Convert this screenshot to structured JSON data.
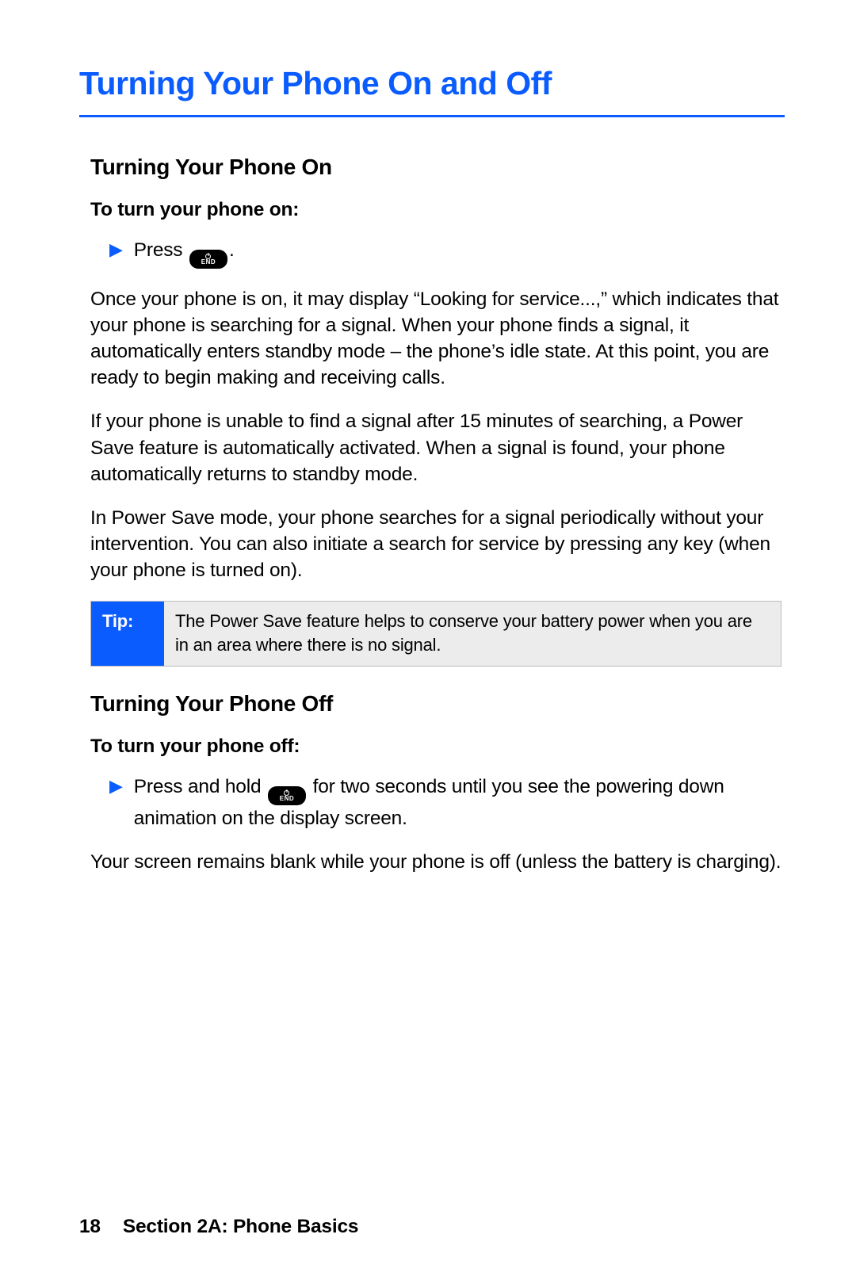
{
  "title": "Turning Your Phone On and Off",
  "section_on": {
    "heading": "Turning Your Phone On",
    "subheading": "To turn your phone on:",
    "step_prefix": "Press ",
    "step_suffix": ".",
    "key_label": "END",
    "p1": "Once your phone is on, it may display “Looking for service...,” which indicates that your phone is searching for a signal. When your phone finds a signal, it automatically enters standby mode – the phone’s idle state. At this point, you are ready to begin making and receiving calls.",
    "p2": "If your phone is unable to find a signal after 15 minutes of searching, a Power Save feature is automatically activated. When a signal is found, your phone automatically returns to standby mode.",
    "p3": "In Power Save mode, your phone searches for a signal periodically without your intervention. You can also initiate a search for service by pressing any key (when your phone is turned on)."
  },
  "tip": {
    "label": "Tip:",
    "body": "The Power Save feature helps to conserve your battery power when you are in an area where there is no signal."
  },
  "section_off": {
    "heading": "Turning Your Phone Off",
    "subheading": "To turn your phone off:",
    "step_prefix": "Press and hold ",
    "step_suffix": " for two seconds until you see the powering down animation on the display screen.",
    "key_label": "END",
    "p1": "Your screen remains blank while your phone is off (unless the battery is charging)."
  },
  "footer": {
    "page": "18",
    "section": "Section 2A: Phone Basics"
  }
}
